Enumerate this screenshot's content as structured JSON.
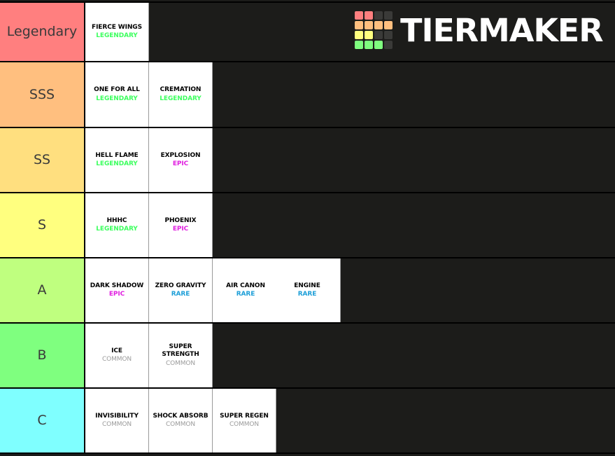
{
  "brand": {
    "name": "TIERMAKER",
    "logo_grid": [
      [
        "#ff7f7f",
        "#ff7f7f",
        "#3a3a38",
        "#3a3a38"
      ],
      [
        "#ffbf7f",
        "#ffbf7f",
        "#ffbf7f",
        "#ffbf7f"
      ],
      [
        "#ffff7f",
        "#ffff7f",
        "#3a3a38",
        "#3a3a38"
      ],
      [
        "#7fff7f",
        "#7fff7f",
        "#7fff7f",
        "#3a3a38"
      ]
    ]
  },
  "colors": {
    "background": "#1c1c1a",
    "tile": "#ffffff",
    "legendary": "#3cff5e",
    "epic": "#e020e0",
    "rare": "#1e9fd8",
    "common": "#9b9b9b"
  },
  "rows": [
    {
      "label": "Legendary",
      "color": "#ff7f7f",
      "items": [
        {
          "name": "FIERCE WINGS",
          "rarity": "LEGENDARY",
          "rarity_class": "r-legendary"
        }
      ]
    },
    {
      "label": "SSS",
      "color": "#ffbf7f",
      "items": [
        {
          "name": "ONE FOR ALL",
          "rarity": "LEGENDARY",
          "rarity_class": "r-legendary"
        },
        {
          "name": "CREMATION",
          "rarity": "LEGENDARY",
          "rarity_class": "r-legendary"
        }
      ]
    },
    {
      "label": "SS",
      "color": "#ffdf7f",
      "items": [
        {
          "name": "HELL FLAME",
          "rarity": "LEGENDARY",
          "rarity_class": "r-legendary"
        },
        {
          "name": "EXPLOSION",
          "rarity": "EPIC",
          "rarity_class": "r-epic"
        }
      ]
    },
    {
      "label": "S",
      "color": "#ffff7f",
      "items": [
        {
          "name": "HHHC",
          "rarity": "LEGENDARY",
          "rarity_class": "r-legendary"
        },
        {
          "name": "PHOENIX",
          "rarity": "EPIC",
          "rarity_class": "r-epic"
        }
      ]
    },
    {
      "label": "A",
      "color": "#bfff7f",
      "items": [
        {
          "name": "DARK SHADOW",
          "rarity": "EPIC",
          "rarity_class": "r-epic"
        },
        {
          "name": "ZERO GRAVITY",
          "rarity": "RARE",
          "rarity_class": "r-rare"
        },
        {
          "wide": true,
          "subitems": [
            {
              "name": "AIR CANON",
              "rarity": "RARE",
              "rarity_class": "r-rare"
            },
            {
              "name": "ENGINE",
              "rarity": "RARE",
              "rarity_class": "r-rare"
            }
          ]
        }
      ]
    },
    {
      "label": "B",
      "color": "#7fff7f",
      "items": [
        {
          "name": "ICE",
          "rarity": "COMMON",
          "rarity_class": "r-common"
        },
        {
          "name": "SUPER STRENGTH",
          "rarity": "COMMON",
          "rarity_class": "r-common"
        }
      ]
    },
    {
      "label": "C",
      "color": "#7fffff",
      "items": [
        {
          "name": "INVISIBILITY",
          "rarity": "COMMON",
          "rarity_class": "r-common"
        },
        {
          "name": "SHOCK ABSORB",
          "rarity": "COMMON",
          "rarity_class": "r-common"
        },
        {
          "name": "SUPER REGEN",
          "rarity": "COMMON",
          "rarity_class": "r-common"
        }
      ]
    }
  ]
}
